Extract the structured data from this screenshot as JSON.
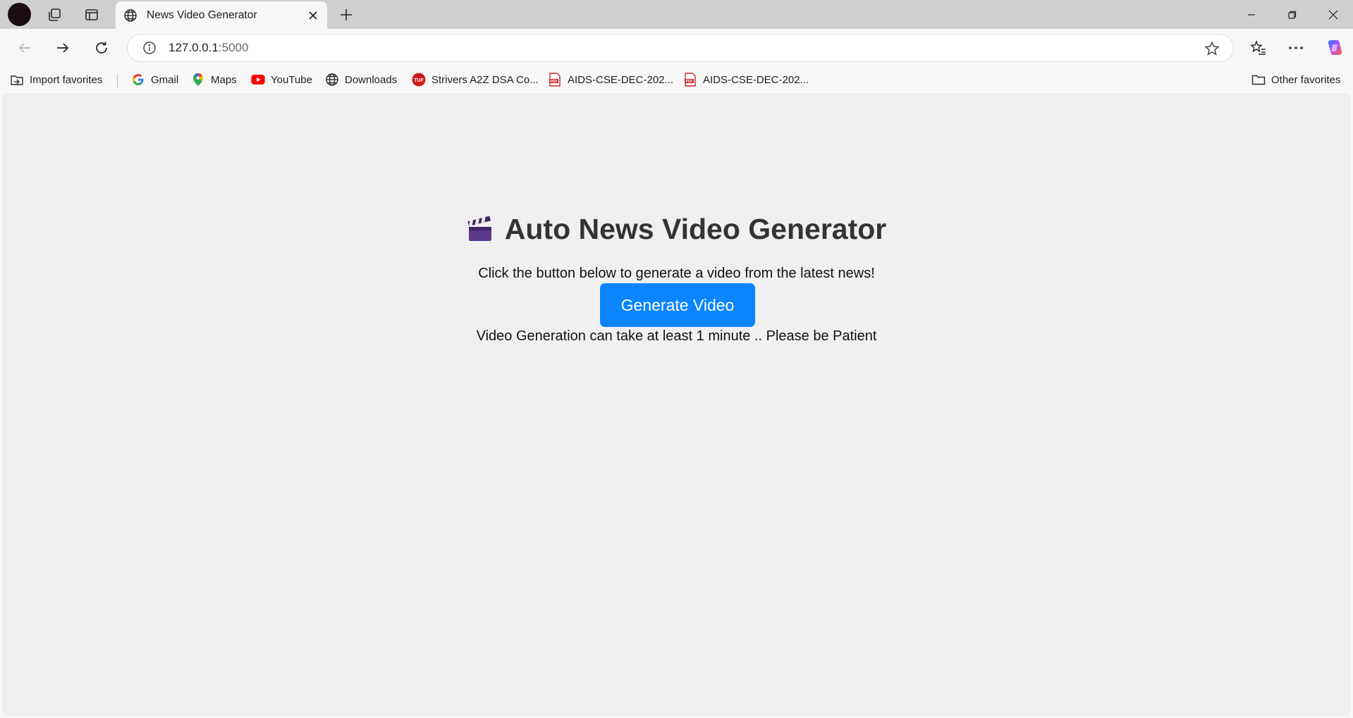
{
  "browser": {
    "tab": {
      "title": "News Video Generator",
      "favicon": "globe-icon"
    },
    "new_tab_symbol": "+",
    "address": {
      "host": "127.0.0.1",
      "port": ":5000"
    },
    "bookmarks": [
      {
        "label": "Import favorites",
        "icon": "import-icon"
      },
      {
        "label": "Gmail",
        "icon": "google-icon"
      },
      {
        "label": "Maps",
        "icon": "maps-pin-icon"
      },
      {
        "label": "YouTube",
        "icon": "youtube-icon"
      },
      {
        "label": "Downloads",
        "icon": "globe-icon"
      },
      {
        "label": "Strivers A2Z DSA Co...",
        "icon": "tuf-icon"
      },
      {
        "label": "AIDS-CSE-DEC-202...",
        "icon": "pdf-icon"
      },
      {
        "label": "AIDS-CSE-DEC-202...",
        "icon": "pdf-icon"
      }
    ],
    "other_favorites": "Other favorites"
  },
  "page": {
    "heading_icon": "clapperboard-icon",
    "heading": "Auto News Video Generator",
    "subtitle": "Click the button below to generate a video from the latest news!",
    "generate_button": "Generate Video",
    "note": "Video Generation can take at least 1 minute .. Please be Patient"
  },
  "colors": {
    "button": "#0a84ff",
    "page_background": "#f0f0f0",
    "heading": "#333333"
  }
}
